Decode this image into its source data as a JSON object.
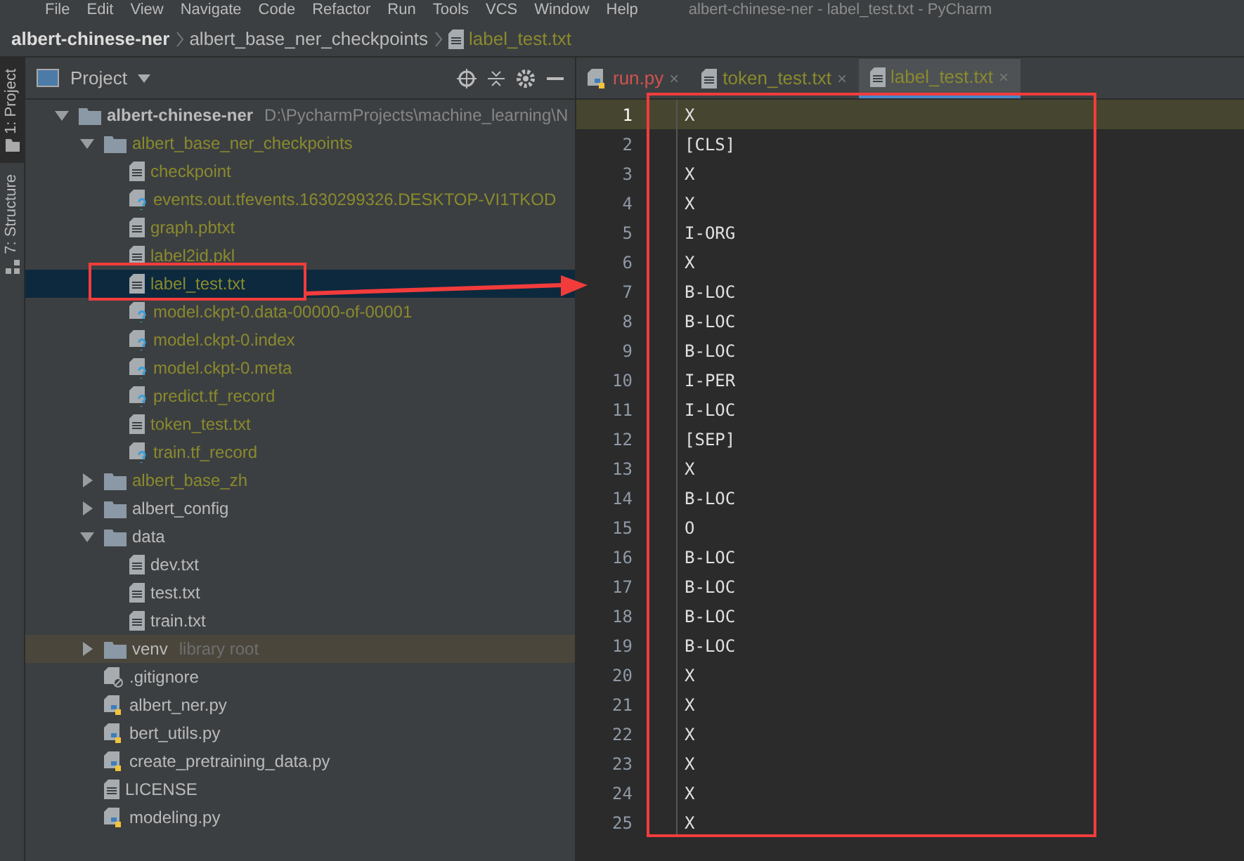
{
  "menu_bar": {
    "items": [
      "File",
      "Edit",
      "View",
      "Navigate",
      "Code",
      "Refactor",
      "Run",
      "Tools",
      "VCS",
      "Window",
      "Help"
    ],
    "title": "albert-chinese-ner - label_test.txt - PyCharm"
  },
  "breadcrumbs": [
    {
      "label": "albert-chinese-ner",
      "kind": "project"
    },
    {
      "label": "albert_base_ner_checkpoints",
      "kind": "folder"
    },
    {
      "label": "label_test.txt",
      "kind": "file"
    }
  ],
  "tool_strip": [
    {
      "label": "1: Project",
      "selected": true,
      "kind": "folder"
    },
    {
      "label": "7: Structure",
      "selected": false,
      "kind": "structure"
    }
  ],
  "project_panel": {
    "title": "Project",
    "tree": [
      {
        "label": "albert-chinese-ner",
        "path": "D:\\PycharmProjects\\machine_learning\\N",
        "kind": "folder",
        "expanded": true,
        "ignored": false,
        "selected": false,
        "children": [
          {
            "label": "albert_base_ner_checkpoints",
            "kind": "folder",
            "expanded": true,
            "ignored": true,
            "selected": false,
            "children": [
              {
                "label": "checkpoint",
                "kind": "text",
                "ignored": true,
                "selected": false
              },
              {
                "label": "events.out.tfevents.1630299326.DESKTOP-VI1TKOD",
                "kind": "unknown",
                "ignored": true,
                "selected": false
              },
              {
                "label": "graph.pbtxt",
                "kind": "text",
                "ignored": true,
                "selected": false
              },
              {
                "label": "label2id.pkl",
                "kind": "text",
                "ignored": true,
                "selected": false
              },
              {
                "label": "label_test.txt",
                "kind": "text",
                "ignored": true,
                "selected": true
              },
              {
                "label": "model.ckpt-0.data-00000-of-00001",
                "kind": "unknown",
                "ignored": true,
                "selected": false
              },
              {
                "label": "model.ckpt-0.index",
                "kind": "unknown",
                "ignored": true,
                "selected": false
              },
              {
                "label": "model.ckpt-0.meta",
                "kind": "unknown",
                "ignored": true,
                "selected": false
              },
              {
                "label": "predict.tf_record",
                "kind": "unknown",
                "ignored": true,
                "selected": false
              },
              {
                "label": "token_test.txt",
                "kind": "text",
                "ignored": true,
                "selected": false
              },
              {
                "label": "train.tf_record",
                "kind": "unknown",
                "ignored": true,
                "selected": false
              }
            ]
          },
          {
            "label": "albert_base_zh",
            "kind": "folder",
            "expanded": false,
            "ignored": true,
            "selected": false
          },
          {
            "label": "albert_config",
            "kind": "folder",
            "expanded": false,
            "ignored": false,
            "selected": false
          },
          {
            "label": "data",
            "kind": "folder",
            "expanded": true,
            "ignored": false,
            "selected": false,
            "children": [
              {
                "label": "dev.txt",
                "kind": "text",
                "ignored": false,
                "selected": false
              },
              {
                "label": "test.txt",
                "kind": "text",
                "ignored": false,
                "selected": false
              },
              {
                "label": "train.txt",
                "kind": "text",
                "ignored": false,
                "selected": false
              }
            ]
          },
          {
            "label": "venv",
            "note": "library root",
            "kind": "folder",
            "expanded": false,
            "ignored": false,
            "selected": false
          },
          {
            "label": ".gitignore",
            "kind": "gitignore",
            "ignored": false,
            "selected": false
          },
          {
            "label": "albert_ner.py",
            "kind": "python",
            "ignored": false,
            "selected": false
          },
          {
            "label": "bert_utils.py",
            "kind": "python",
            "ignored": false,
            "selected": false
          },
          {
            "label": "create_pretraining_data.py",
            "kind": "python",
            "ignored": false,
            "selected": false
          },
          {
            "label": "LICENSE",
            "kind": "text",
            "ignored": false,
            "selected": false
          },
          {
            "label": "modeling.py",
            "kind": "python",
            "ignored": false,
            "selected": false
          }
        ]
      }
    ]
  },
  "editor": {
    "tabs": [
      {
        "label": "run.py",
        "kind": "python",
        "color": "#d25252",
        "close": "×",
        "selected": false
      },
      {
        "label": "token_test.txt",
        "kind": "text",
        "color": "#8a8a2e",
        "close": "×",
        "selected": false
      },
      {
        "label": "label_test.txt",
        "kind": "text",
        "color": "#8a8a2e",
        "close": "×",
        "selected": true
      }
    ],
    "lines": [
      {
        "number": "1",
        "text": "X",
        "current": true
      },
      {
        "number": "2",
        "text": "[CLS]",
        "current": false
      },
      {
        "number": "3",
        "text": "X",
        "current": false
      },
      {
        "number": "4",
        "text": "X",
        "current": false
      },
      {
        "number": "5",
        "text": "I-ORG",
        "current": false
      },
      {
        "number": "6",
        "text": "X",
        "current": false
      },
      {
        "number": "7",
        "text": "B-LOC",
        "current": false
      },
      {
        "number": "8",
        "text": "B-LOC",
        "current": false
      },
      {
        "number": "9",
        "text": "B-LOC",
        "current": false
      },
      {
        "number": "10",
        "text": "I-PER",
        "current": false
      },
      {
        "number": "11",
        "text": "I-LOC",
        "current": false
      },
      {
        "number": "12",
        "text": "[SEP]",
        "current": false
      },
      {
        "number": "13",
        "text": "X",
        "current": false
      },
      {
        "number": "14",
        "text": "B-LOC",
        "current": false
      },
      {
        "number": "15",
        "text": "O",
        "current": false
      },
      {
        "number": "16",
        "text": "B-LOC",
        "current": false
      },
      {
        "number": "17",
        "text": "B-LOC",
        "current": false
      },
      {
        "number": "18",
        "text": "B-LOC",
        "current": false
      },
      {
        "number": "19",
        "text": "B-LOC",
        "current": false
      },
      {
        "number": "20",
        "text": "X",
        "current": false
      },
      {
        "number": "21",
        "text": "X",
        "current": false
      },
      {
        "number": "22",
        "text": "X",
        "current": false
      },
      {
        "number": "23",
        "text": "X",
        "current": false
      },
      {
        "number": "24",
        "text": "X",
        "current": false
      },
      {
        "number": "25",
        "text": "X",
        "current": false
      }
    ]
  }
}
